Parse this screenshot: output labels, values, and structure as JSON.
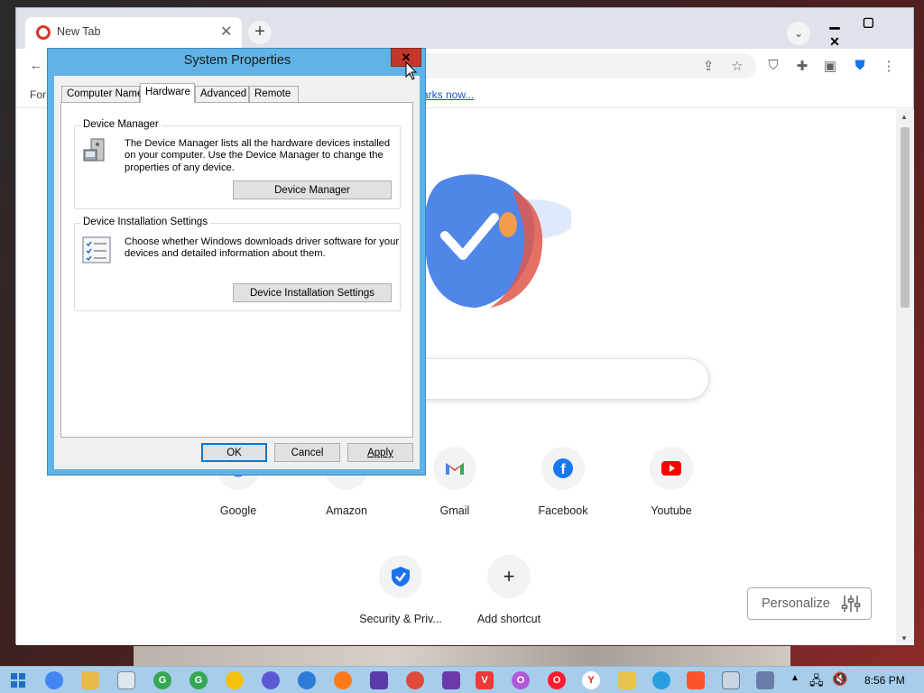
{
  "browser": {
    "tab_title": "New Tab",
    "bookmarks_left": "For",
    "bookmarks_link": "arks now...",
    "window_controls": {
      "minimize": "▁",
      "maximize": "▢",
      "close": "✕"
    }
  },
  "dialog": {
    "title": "System Properties",
    "close_label": "✕",
    "tabs": [
      "Computer Name",
      "Hardware",
      "Advanced",
      "Remote"
    ],
    "active_tab": "Hardware",
    "device_manager": {
      "legend": "Device Manager",
      "line1": "The Device Manager lists all the hardware devices installed",
      "line2": "on your computer. Use the Device Manager to change the",
      "line3": "properties of any device.",
      "button": "Device Manager"
    },
    "device_installation": {
      "legend": "Device Installation Settings",
      "line1": "Choose whether Windows downloads driver software for your",
      "line2": "devices and detailed information about them.",
      "button": "Device Installation Settings"
    },
    "ok_label": "OK",
    "cancel_label": "Cancel",
    "apply_label": "Apply"
  },
  "newtab": {
    "shortcuts": [
      {
        "label": "Google",
        "icon": "google-icon"
      },
      {
        "label": "Amazon",
        "icon": "amazon-icon"
      },
      {
        "label": "Gmail",
        "icon": "gmail-icon"
      },
      {
        "label": "Facebook",
        "icon": "facebook-icon"
      },
      {
        "label": "Youtube",
        "icon": "youtube-icon"
      },
      {
        "label": "Security & Priv...",
        "icon": "shield-check-icon"
      },
      {
        "label": "Add shortcut",
        "icon": "plus-icon"
      }
    ],
    "personalize_label": "Personalize"
  },
  "taskbar": {
    "clock": "8:56 PM"
  },
  "colors": {
    "dialog_frame": "#5fb3e6",
    "close_red": "#c3372b",
    "taskbar": "#a7cdea",
    "link_blue": "#1a55c4"
  }
}
